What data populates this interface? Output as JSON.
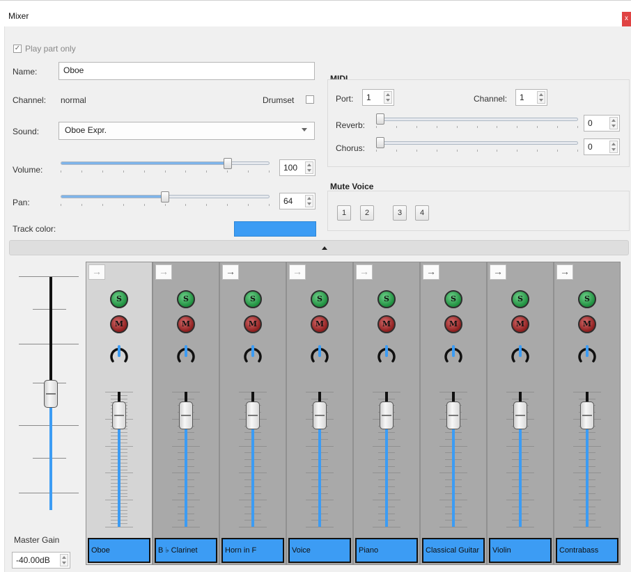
{
  "window": {
    "title": "Mixer",
    "close_label": "x"
  },
  "top": {
    "play_part_only": {
      "label": "Play part only",
      "checked": true
    },
    "name": {
      "label": "Name:",
      "value": "Oboe"
    },
    "channel": {
      "label": "Channel:",
      "value": "normal"
    },
    "drumset": {
      "label": "Drumset",
      "checked": false
    },
    "sound": {
      "label": "Sound:",
      "value": "Oboe Expr."
    },
    "volume": {
      "label": "Volume:",
      "value": "100",
      "level": 0.8
    },
    "pan": {
      "label": "Pan:",
      "value": "64",
      "level": 0.5
    },
    "track_color": {
      "label": "Track color:",
      "color": "#3c9cf4"
    }
  },
  "midi": {
    "title": "MIDI",
    "port": {
      "label": "Port:",
      "value": "1"
    },
    "channel": {
      "label": "Channel:",
      "value": "1"
    },
    "reverb": {
      "label": "Reverb:",
      "value": "0"
    },
    "chorus": {
      "label": "Chorus:",
      "value": "0"
    }
  },
  "mute_voice": {
    "title": "Mute Voice",
    "buttons": [
      "1",
      "2",
      "3",
      "4"
    ]
  },
  "master": {
    "label": "Master Gain",
    "value": "-40.00dB",
    "level": 0.5
  },
  "strips": [
    {
      "name": "Oboe",
      "selected": true,
      "arrow": "→",
      "solo": "S",
      "mute": "M"
    },
    {
      "name": "B ♭ Clarinet",
      "selected": false,
      "arrow": "→",
      "solo": "S",
      "mute": "M"
    },
    {
      "name": "Horn in F",
      "selected": false,
      "arrow": "→",
      "solo": "S",
      "mute": "M"
    },
    {
      "name": "Voice",
      "selected": false,
      "arrow": "→",
      "solo": "S",
      "mute": "M"
    },
    {
      "name": "Piano",
      "selected": false,
      "arrow": "→",
      "solo": "S",
      "mute": "M"
    },
    {
      "name": "Classical Guitar",
      "selected": false,
      "arrow": "→",
      "solo": "S",
      "mute": "M"
    },
    {
      "name": "Violin",
      "selected": false,
      "arrow": "→",
      "solo": "S",
      "mute": "M"
    },
    {
      "name": "Contrabass",
      "selected": false,
      "arrow": "→",
      "solo": "S",
      "mute": "M"
    }
  ],
  "colors": {
    "accent": "#3c9cf4",
    "solo": "#1f8f3f",
    "mute": "#8e1f1f"
  }
}
